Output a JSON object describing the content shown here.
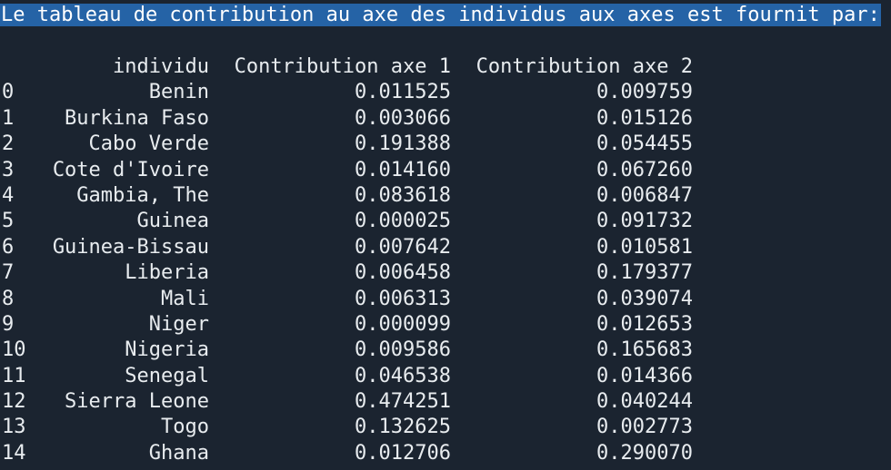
{
  "title": "Le tableau de contribution au axe des individus aux axes est fournit par:",
  "table": {
    "headers": {
      "index": "",
      "name": "individu",
      "axe1": "Contribution axe 1",
      "axe2": "Contribution axe 2"
    },
    "rows": [
      {
        "index": "0",
        "name": "Benin",
        "axe1": "0.011525",
        "axe2": "0.009759"
      },
      {
        "index": "1",
        "name": "Burkina Faso",
        "axe1": "0.003066",
        "axe2": "0.015126"
      },
      {
        "index": "2",
        "name": "Cabo Verde",
        "axe1": "0.191388",
        "axe2": "0.054455"
      },
      {
        "index": "3",
        "name": "Cote d'Ivoire",
        "axe1": "0.014160",
        "axe2": "0.067260"
      },
      {
        "index": "4",
        "name": "Gambia, The",
        "axe1": "0.083618",
        "axe2": "0.006847"
      },
      {
        "index": "5",
        "name": "Guinea",
        "axe1": "0.000025",
        "axe2": "0.091732"
      },
      {
        "index": "6",
        "name": "Guinea-Bissau",
        "axe1": "0.007642",
        "axe2": "0.010581"
      },
      {
        "index": "7",
        "name": "Liberia",
        "axe1": "0.006458",
        "axe2": "0.179377"
      },
      {
        "index": "8",
        "name": "Mali",
        "axe1": "0.006313",
        "axe2": "0.039074"
      },
      {
        "index": "9",
        "name": "Niger",
        "axe1": "0.000099",
        "axe2": "0.012653"
      },
      {
        "index": "10",
        "name": "Nigeria",
        "axe1": "0.009586",
        "axe2": "0.165683"
      },
      {
        "index": "11",
        "name": "Senegal",
        "axe1": "0.046538",
        "axe2": "0.014366"
      },
      {
        "index": "12",
        "name": "Sierra Leone",
        "axe1": "0.474251",
        "axe2": "0.040244"
      },
      {
        "index": "13",
        "name": "Togo",
        "axe1": "0.132625",
        "axe2": "0.002773"
      },
      {
        "index": "14",
        "name": "Ghana",
        "axe1": "0.012706",
        "axe2": "0.290070"
      }
    ]
  },
  "colors": {
    "background": "#1b2430",
    "text": "#e8ecef",
    "selection": "#2563a6"
  }
}
